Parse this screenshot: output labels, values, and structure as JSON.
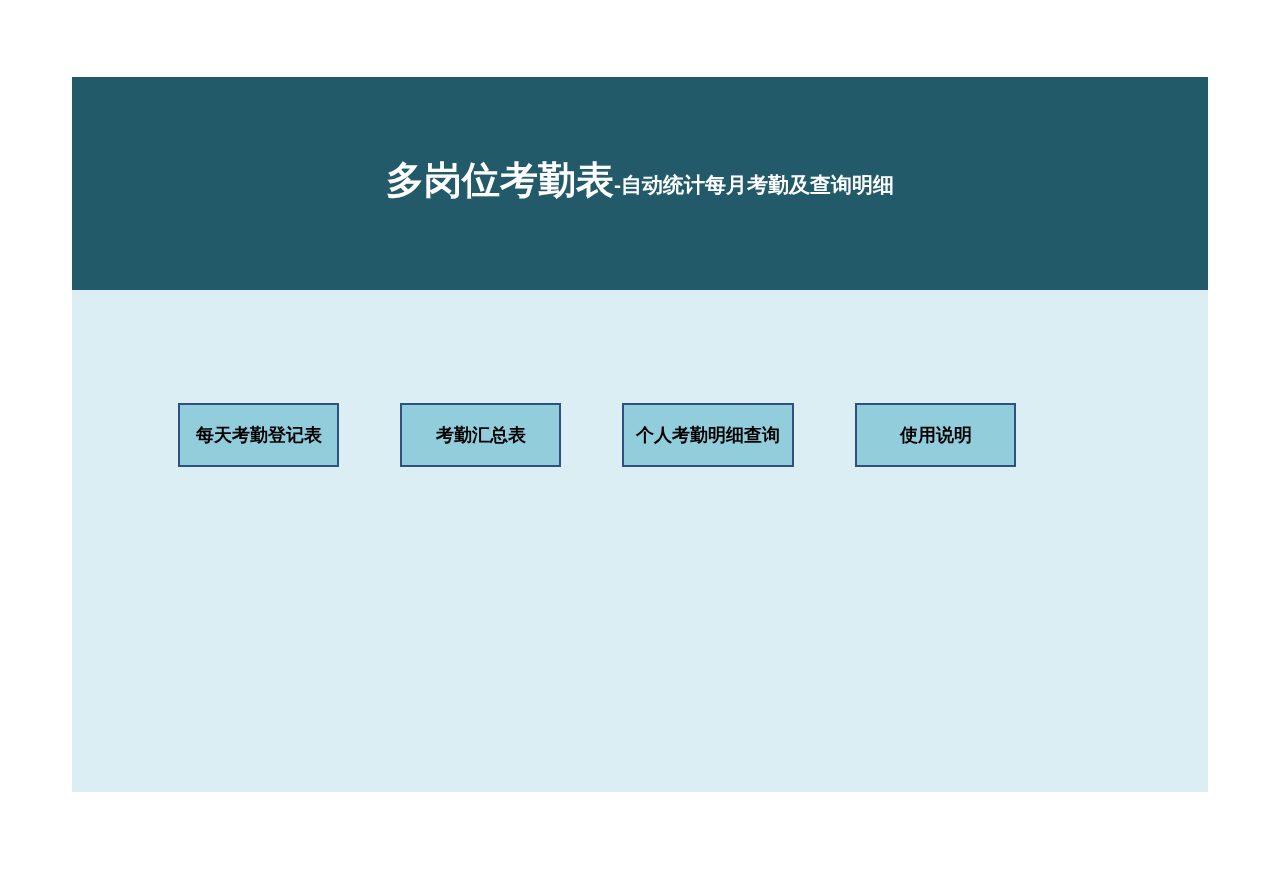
{
  "header": {
    "title": "多岗位考勤表",
    "subtitle": "-自动统计每月考勤及查询明细"
  },
  "buttons": [
    "每天考勤登记表",
    "考勤汇总表",
    "个人考勤明细查询",
    "使用说明"
  ]
}
